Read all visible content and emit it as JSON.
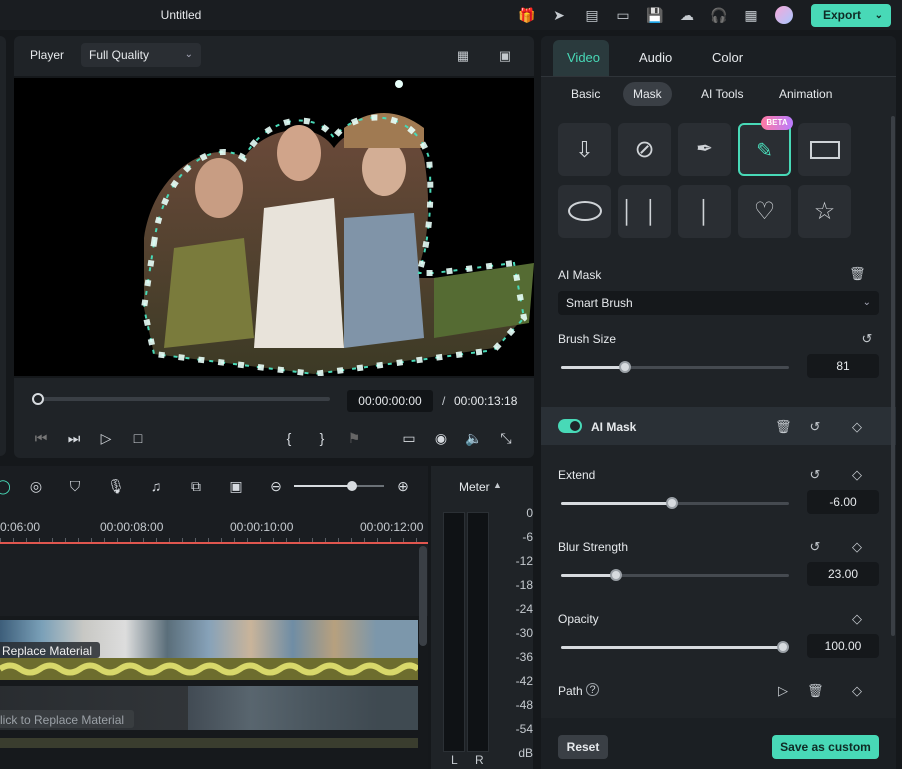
{
  "app": {
    "title": "Untitled",
    "export_label": "Export"
  },
  "player": {
    "label": "Player",
    "quality": "Full Quality",
    "current_time": "00:00:00:00",
    "separator": "/",
    "total_time": "00:00:13:18"
  },
  "timeline": {
    "ruler": [
      "0:06:00",
      "00:00:08:00",
      "00:00:10:00",
      "00:00:12:00"
    ],
    "clip1_label": "Replace Material",
    "clip2_label": "lick to Replace Material"
  },
  "meter": {
    "title": "Meter",
    "scale": [
      "0",
      "-6",
      "-12",
      "-18",
      "-24",
      "-30",
      "-36",
      "-42",
      "-48",
      "-54",
      "dB"
    ],
    "left": "L",
    "right": "R"
  },
  "right_panel": {
    "tabs": [
      "Video",
      "Audio",
      "Color"
    ],
    "active_tab": "Video",
    "subtabs": [
      "Basic",
      "Mask",
      "AI Tools",
      "Animation"
    ],
    "active_subtab": "Mask",
    "beta_badge": "BETA",
    "mask_shapes": [
      "import-mask",
      "none",
      "pen",
      "smart-brush",
      "rectangle",
      "ellipse",
      "double-line",
      "single-line",
      "heart",
      "star"
    ],
    "ai_mask_label": "AI Mask",
    "ai_mask_mode": "Smart Brush",
    "brush_size": {
      "label": "Brush Size",
      "value": "81",
      "level": 0.18
    },
    "ai_mask_toggle": {
      "label": "AI Mask",
      "on": true
    },
    "extend": {
      "label": "Extend",
      "value": "-6.00",
      "level": 0.49
    },
    "blur": {
      "label": "Blur Strength",
      "value": "23.00",
      "level": 0.23
    },
    "opacity": {
      "label": "Opacity",
      "value": "100.00",
      "level": 1.0
    },
    "path_label": "Path",
    "reset_label": "Reset",
    "save_label": "Save as custom"
  },
  "colors": {
    "accent": "#48d9b7",
    "background": "#15181b",
    "panel": "#1f2327"
  }
}
